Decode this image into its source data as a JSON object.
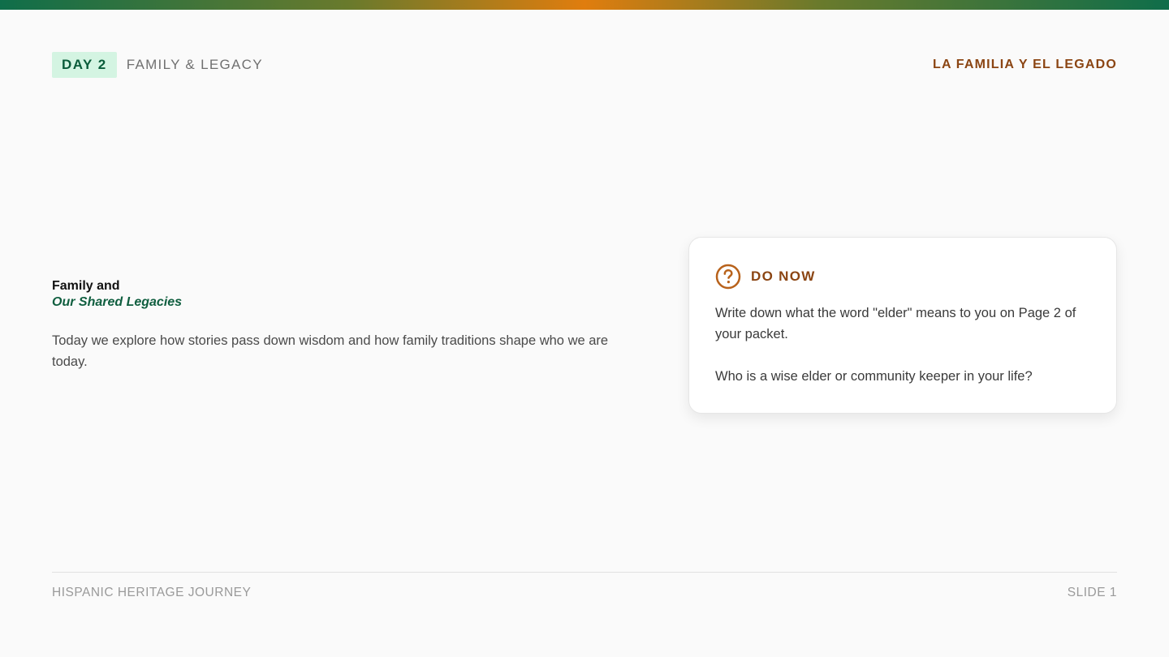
{
  "header": {
    "day_label": "DAY 2",
    "subtitle": "FAMILY & LEGACY",
    "spanish_title": "LA FAMILIA Y EL LEGADO"
  },
  "main": {
    "title_line1": "Family and",
    "title_line2": "Our Shared Legacies",
    "intro": "Today we explore how stories pass down wisdom and how family traditions shape who we are today."
  },
  "do_now": {
    "icon": "question-circle-icon",
    "title": "DO NOW",
    "prompt": "Write down what the word \"elder\" means to you on Page 2 of your packet.",
    "question": "Who is a wise elder or community keeper in your life?"
  },
  "footer": {
    "course": "HISPANIC HERITAGE JOURNEY",
    "slide": "SLIDE 1"
  },
  "colors": {
    "accent_green": "#0f5e3f",
    "accent_brown": "#8b4513",
    "accent_orange": "#e07d0e",
    "badge_bg": "#d4f4e2"
  }
}
